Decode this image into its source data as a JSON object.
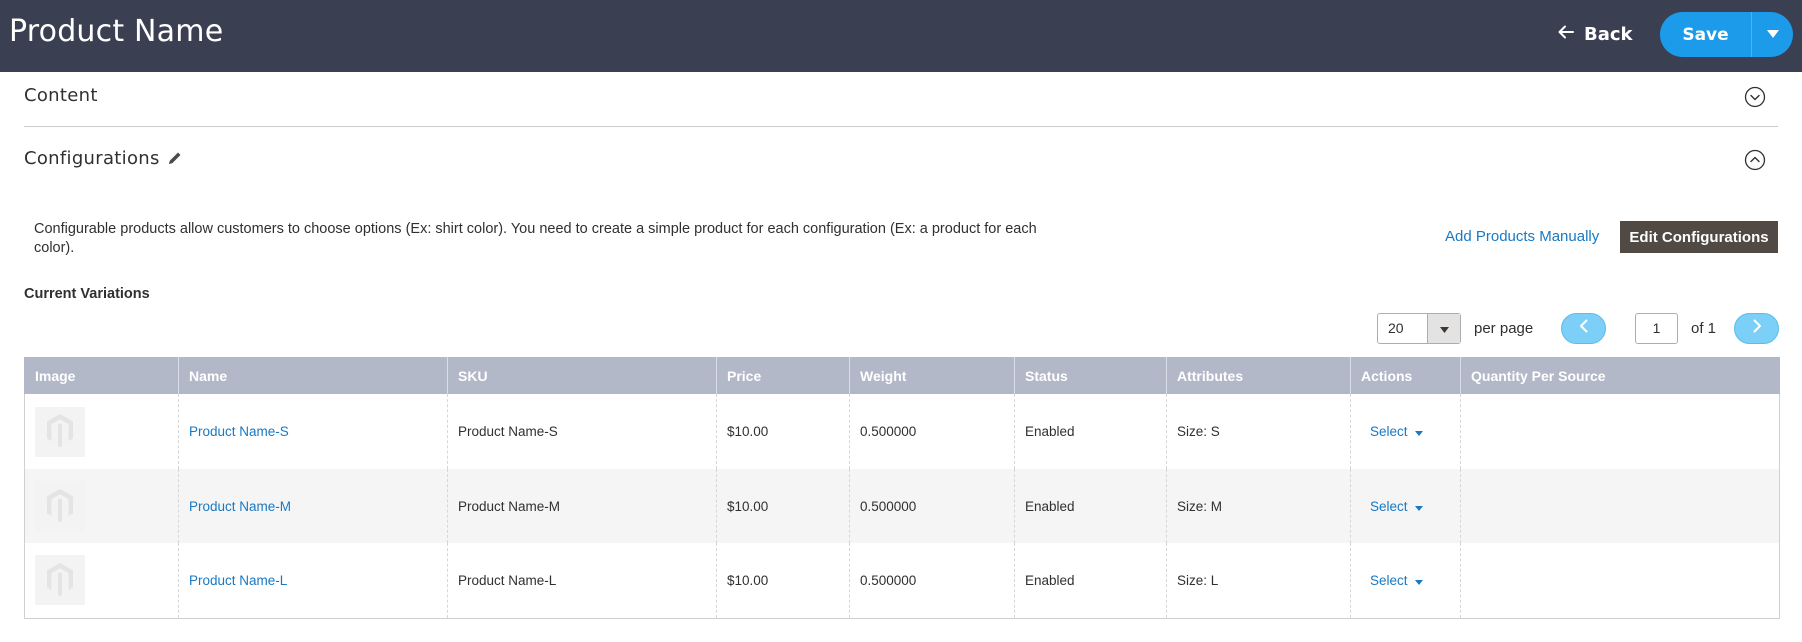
{
  "header": {
    "title": "Product Name",
    "back_label": "Back",
    "save_label": "Save"
  },
  "sections": {
    "content_title": "Content",
    "configurations_title": "Configurations"
  },
  "configurations": {
    "description": "Configurable products allow customers to choose options (Ex: shirt color). You need to create a simple product for each configuration (Ex: a product for each color).",
    "add_manually_label": "Add Products Manually",
    "edit_configurations_label": "Edit Configurations",
    "current_variations_label": "Current Variations"
  },
  "pager": {
    "per_page_value": "20",
    "per_page_label": "per page",
    "current_page": "1",
    "of_label": "of 1"
  },
  "table": {
    "columns": [
      "Image",
      "Name",
      "SKU",
      "Price",
      "Weight",
      "Status",
      "Attributes",
      "Actions",
      "Quantity Per Source"
    ],
    "rows": [
      {
        "name": "Product Name-S",
        "sku": "Product Name-S",
        "price": "$10.00",
        "weight": "0.500000",
        "status": "Enabled",
        "attributes": "Size: S",
        "action": "Select",
        "qty": ""
      },
      {
        "name": "Product Name-M",
        "sku": "Product Name-M",
        "price": "$10.00",
        "weight": "0.500000",
        "status": "Enabled",
        "attributes": "Size: M",
        "action": "Select",
        "qty": ""
      },
      {
        "name": "Product Name-L",
        "sku": "Product Name-L",
        "price": "$10.00",
        "weight": "0.500000",
        "status": "Enabled",
        "attributes": "Size: L",
        "action": "Select",
        "qty": ""
      }
    ]
  },
  "colors": {
    "header_bg": "#3b3f52",
    "primary_button": "#1c9bea",
    "edit_configurations_bg": "#514943",
    "link": "#1979c3",
    "table_header_bg": "#b3b8c9",
    "pager_button": "#7ccff6"
  },
  "icons": {
    "back": "arrow-left-icon",
    "save_toggle": "caret-down-icon",
    "content_toggle": "chevron-down-circle-icon",
    "configurations_toggle": "chevron-up-circle-icon",
    "edit": "pencil-icon",
    "per_page_toggle": "caret-down-icon",
    "prev_page": "chevron-left-icon",
    "next_page": "chevron-right-icon",
    "thumbnail": "magento-placeholder-icon",
    "action_toggle": "caret-down-icon"
  }
}
